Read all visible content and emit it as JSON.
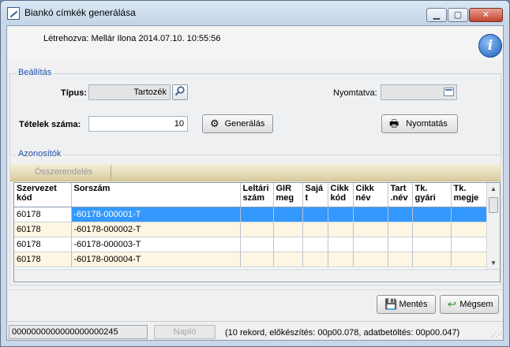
{
  "window": {
    "title": "Biankó címkék generálása",
    "min_glyph": "▁",
    "max_glyph": "▢",
    "close_glyph": "✕"
  },
  "header": {
    "created_label": "Létrehozva:",
    "created_by": "Mellár Ilona",
    "created_at": "2014.07.10. 10:55:56",
    "info_glyph": "i"
  },
  "settings": {
    "group_label": "Beállítás",
    "type_label": "Típus:",
    "type_value": "Tartozék",
    "printed_label": "Nyomtatva:",
    "printed_value": "",
    "count_label": "Tételek száma:",
    "count_value": "10",
    "generate_label": "Generálás",
    "print_label": "Nyomtatás"
  },
  "identifiers": {
    "group_label": "Azonosítók",
    "aggregate_label": "Összerendelés",
    "columns": [
      "Szervezet kód",
      "Sorszám",
      "Leltári szám",
      "GIR meg",
      "Sajá t",
      "Cikk kód",
      "Cikk név",
      "Tart .név",
      "Tk. gyári",
      "Tk. megje"
    ],
    "rows": [
      [
        "60178",
        "-60178-000001-T",
        "",
        "",
        "",
        "",
        "",
        "",
        "",
        ""
      ],
      [
        "60178",
        "-60178-000002-T",
        "",
        "",
        "",
        "",
        "",
        "",
        "",
        ""
      ],
      [
        "60178",
        "-60178-000003-T",
        "",
        "",
        "",
        "",
        "",
        "",
        "",
        ""
      ],
      [
        "60178",
        "-60178-000004-T",
        "",
        "",
        "",
        "",
        "",
        "",
        "",
        ""
      ]
    ]
  },
  "actions": {
    "save_label": "Mentés",
    "cancel_label": "Mégsem"
  },
  "status": {
    "code": "0000000000000000000245",
    "log_label": "Napló",
    "info": "(10 rekord, előkészítés: 00p00.078, adatbetöltés: 00p00.047)"
  }
}
